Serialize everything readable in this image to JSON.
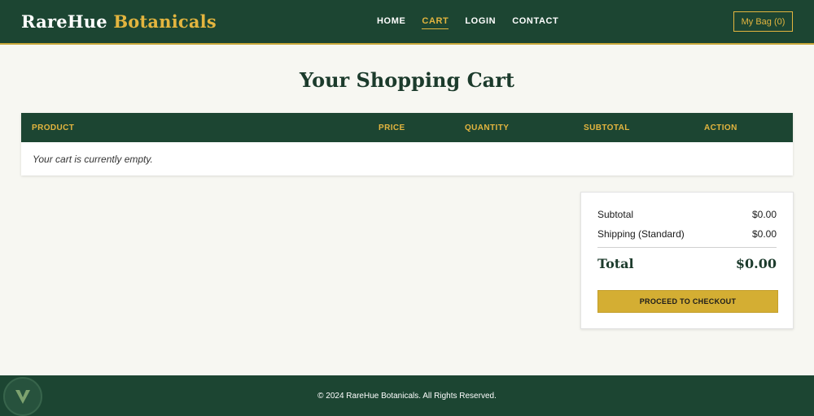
{
  "header": {
    "logo_part1": "RareHue",
    "logo_part2": "Botanicals",
    "nav": [
      "HOME",
      "CART",
      "LOGIN",
      "CONTACT"
    ],
    "active_nav": "CART",
    "bag_label": "My Bag (0)"
  },
  "main": {
    "title": "Your Shopping Cart",
    "table": {
      "columns": [
        "PRODUCT",
        "PRICE",
        "QUANTITY",
        "SUBTOTAL",
        "ACTION"
      ],
      "empty_message": "Your cart is currently empty."
    },
    "summary": {
      "subtotal_label": "Subtotal",
      "subtotal_value": "$0.00",
      "shipping_label": "Shipping (Standard)",
      "shipping_value": "$0.00",
      "total_label": "Total",
      "total_value": "$0.00",
      "checkout_label": "PROCEED TO CHECKOUT"
    }
  },
  "footer": {
    "text": "© 2024 RareHue Botanicals. All Rights Reserved."
  },
  "colors": {
    "primary_green": "#1c4532",
    "accent_gold": "#e3b53f",
    "button_gold": "#d4ae33",
    "background": "#f7f7f2"
  },
  "icons": {
    "corner_badge": "leaf-badge-icon"
  }
}
